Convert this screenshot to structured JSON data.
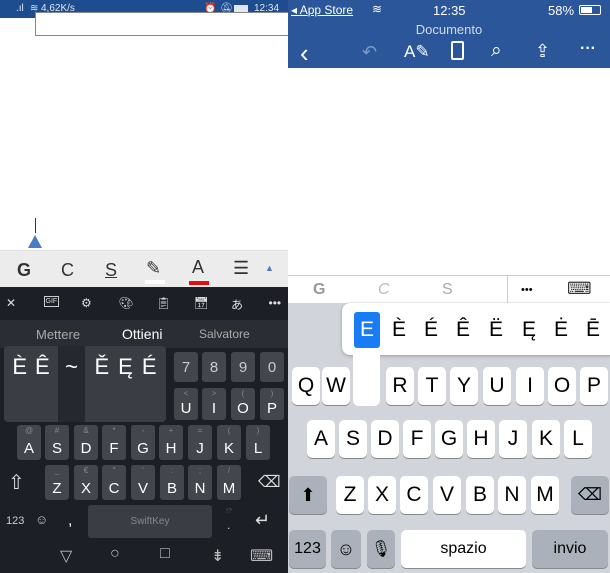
{
  "android": {
    "status": {
      "speed": "4,62K/s",
      "time": "12:34"
    },
    "format_bar": {
      "bold": "G",
      "italic": "C",
      "underline": "S",
      "font_color": "A",
      "accent_red": "#e01010"
    },
    "toolbar_icons": [
      "close-icon",
      "gif-icon",
      "settings-icon",
      "theme-palette-icon",
      "clipboard-icon",
      "calendar-icon",
      "translate-icon",
      "more-icon"
    ],
    "predictions": [
      "Mettere",
      "Ottieni",
      "Salvatore"
    ],
    "accent_popup": {
      "left": [
        "È",
        "Ê"
      ],
      "middle": "~",
      "right": [
        "Ě",
        "Ę",
        "É"
      ]
    },
    "row1": [
      {
        "k": "7"
      },
      {
        "k": "8"
      },
      {
        "k": "9"
      },
      {
        "k": "0"
      }
    ],
    "row2": [
      {
        "k": "U",
        "s": "<"
      },
      {
        "k": "I",
        "s": ">"
      },
      {
        "k": "O",
        "s": "("
      },
      {
        "k": "P",
        "s": ")"
      }
    ],
    "row3": [
      {
        "k": "A",
        "s": "@"
      },
      {
        "k": "S",
        "s": "#"
      },
      {
        "k": "D",
        "s": "&"
      },
      {
        "k": "F",
        "s": "*"
      },
      {
        "k": "G",
        "s": "-"
      },
      {
        "k": "H",
        "s": "+"
      },
      {
        "k": "J",
        "s": "="
      },
      {
        "k": "K",
        "s": "("
      },
      {
        "k": "L",
        "s": ")"
      }
    ],
    "row4": [
      {
        "k": "Z",
        "s": "_"
      },
      {
        "k": "X",
        "s": "€"
      },
      {
        "k": "C",
        "s": "\""
      },
      {
        "k": "V",
        "s": "'"
      },
      {
        "k": "B",
        "s": ":"
      },
      {
        "k": "N",
        "s": ";"
      },
      {
        "k": "M",
        "s": "/"
      }
    ],
    "bottom": {
      "num": "123",
      "comma": ",",
      "space_brand": "SwiftKey",
      "period": ".",
      "period_alt": "!?"
    }
  },
  "ios": {
    "status": {
      "back_app": "App Store",
      "time": "12:35",
      "battery": "58%"
    },
    "title": "Documento",
    "format_bar": {
      "bold": "G",
      "italic": "C",
      "underline": "S",
      "more": "•••"
    },
    "accent_popup": [
      "E",
      "È",
      "É",
      "Ê",
      "Ë",
      "Ę",
      "Ė",
      "Ē"
    ],
    "accent_selected": "E",
    "accent_color": "#1a7cf5",
    "row1": [
      "Q",
      "W",
      "R",
      "T",
      "Y",
      "U",
      "I",
      "O",
      "P"
    ],
    "row2": [
      "A",
      "S",
      "D",
      "F",
      "G",
      "H",
      "J",
      "K",
      "L"
    ],
    "row3": [
      "Z",
      "X",
      "C",
      "V",
      "B",
      "N",
      "M"
    ],
    "bottom": {
      "num": "123",
      "space": "spazio",
      "return": "invio"
    }
  }
}
